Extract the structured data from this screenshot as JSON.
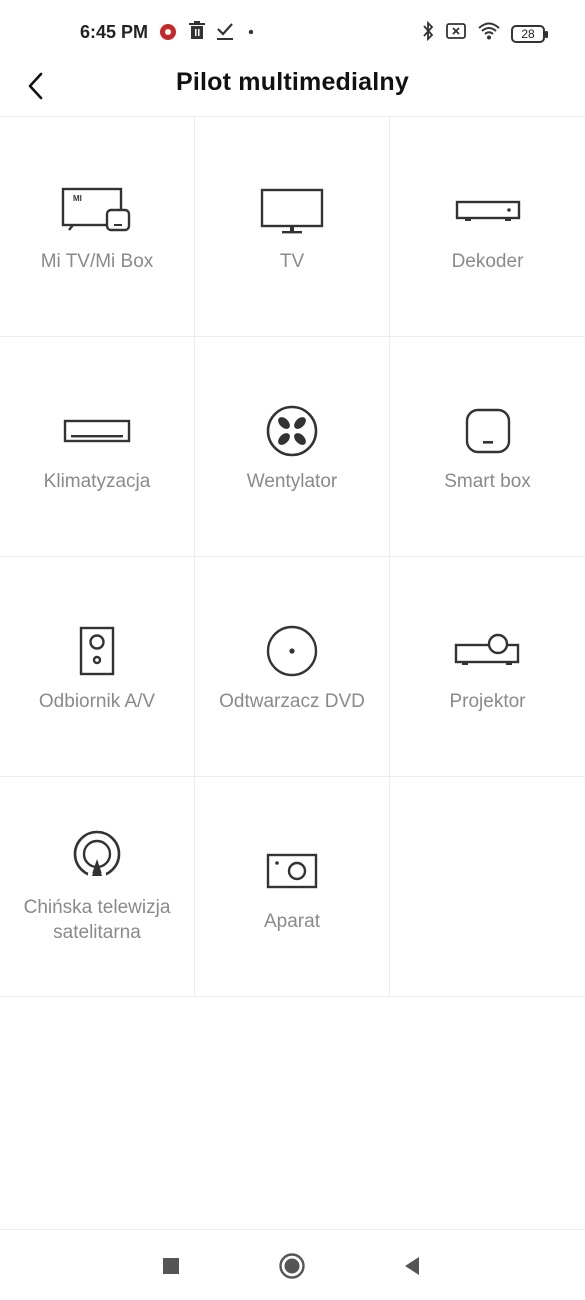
{
  "status_bar": {
    "time": "6:45 PM",
    "left_icons": [
      "app-notification-icon",
      "trash-icon",
      "download-done-icon",
      "dot-icon"
    ],
    "right_icons": [
      "bluetooth-icon",
      "no-sim-icon",
      "wifi-icon"
    ],
    "battery": "28"
  },
  "header": {
    "title": "Pilot multimedialny",
    "back_icon": "chevron-left-icon"
  },
  "devices": [
    {
      "label": "Mi TV/Mi Box",
      "icon": "mi-tv-box-icon"
    },
    {
      "label": "TV",
      "icon": "tv-icon"
    },
    {
      "label": "Dekoder",
      "icon": "set-top-box-icon"
    },
    {
      "label": "Klimatyzacja",
      "icon": "air-conditioner-icon"
    },
    {
      "label": "Wentylator",
      "icon": "fan-icon"
    },
    {
      "label": "Smart box",
      "icon": "smart-box-icon"
    },
    {
      "label": "Odbiornik A/V",
      "icon": "speaker-icon"
    },
    {
      "label": "Odtwarzacz DVD",
      "icon": "dvd-icon"
    },
    {
      "label": "Projektor",
      "icon": "projector-icon"
    },
    {
      "label": "Chińska telewizja satelitarna",
      "icon": "satellite-icon"
    },
    {
      "label": "Aparat",
      "icon": "camera-icon"
    }
  ],
  "nav_bar": {
    "buttons": [
      "recent-apps-icon",
      "home-icon",
      "back-triangle-icon"
    ]
  },
  "colors": {
    "icon": "#333333",
    "label": "#8a8a8a",
    "divider": "#ececec"
  }
}
